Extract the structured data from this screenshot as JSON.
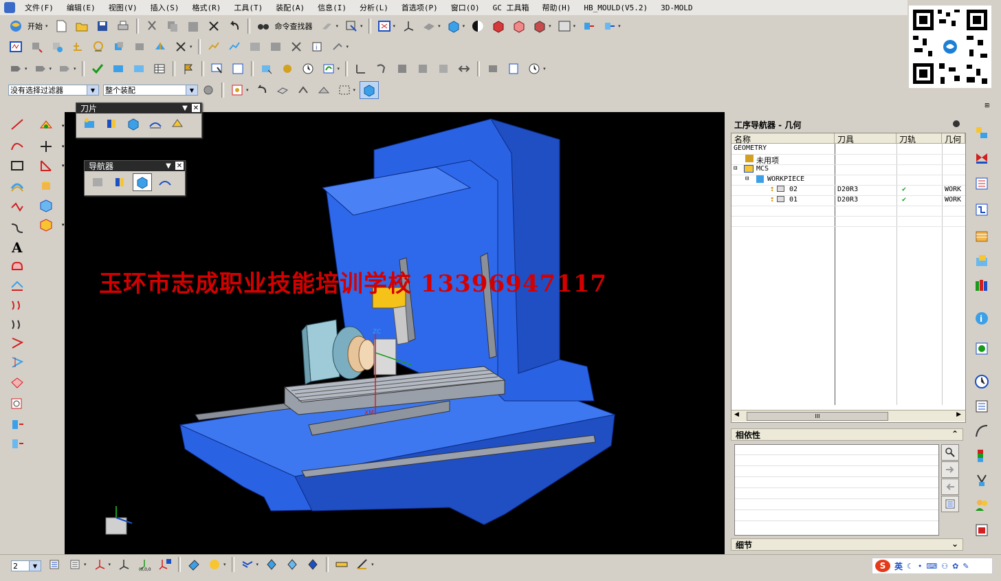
{
  "menu": [
    "文件(F)",
    "编辑(E)",
    "视图(V)",
    "插入(S)",
    "格式(R)",
    "工具(T)",
    "装配(A)",
    "信息(I)",
    "分析(L)",
    "首选项(P)",
    "窗口(O)",
    "GC 工具箱",
    "帮助(H)",
    "HB_MOULD(V5.2)",
    "3D-MOLD"
  ],
  "toolbar": {
    "start_label": "开始",
    "finder_label": "命令查找器"
  },
  "selection": {
    "filter": "没有选择过滤器",
    "scope": "整个装配"
  },
  "palettes": {
    "blade_title": "刀片",
    "navigator_title": "导航器"
  },
  "viewport": {
    "watermark": "玉环市志成职业技能培训学校  13396947117",
    "axis_zc": "ZC",
    "axis_xm": "XM"
  },
  "navigator": {
    "title": "工序导航器 - 几何",
    "columns": [
      "名称",
      "刀具",
      "刀轨",
      "几何"
    ],
    "rows": [
      {
        "name": "GEOMETRY",
        "tool": "",
        "path": "",
        "geom": ""
      },
      {
        "name": "未用项",
        "tool": "",
        "path": "",
        "geom": ""
      },
      {
        "name": "MCS",
        "tool": "",
        "path": "",
        "geom": ""
      },
      {
        "name": "WORKPIECE",
        "tool": "",
        "path": "",
        "geom": ""
      },
      {
        "name": "02",
        "tool": "D20R3",
        "path": "✔",
        "geom": "WORK"
      },
      {
        "name": "01",
        "tool": "D20R3",
        "path": "✔",
        "geom": "WORK"
      }
    ],
    "scroll_label": "III",
    "dependency_label": "相依性",
    "details_label": "细节"
  },
  "bottom": {
    "view_num": "2",
    "ime_lang": "英"
  },
  "colors": {
    "machine_blue": "#2a62e4",
    "watermark_red": "#d40000",
    "check_green": "#1a9a1a"
  }
}
